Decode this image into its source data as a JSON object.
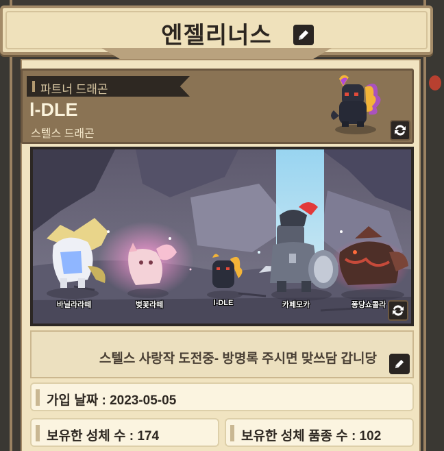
{
  "title": "엔젤리너스",
  "partner": {
    "tag_label": "파트너 드래곤",
    "name": "l-DLE",
    "type": "스텔스 드래곤"
  },
  "scene": {
    "dragons": [
      {
        "name": "바닐라라떼"
      },
      {
        "name": "벚꽃라떼"
      },
      {
        "name": "l-DLE"
      },
      {
        "name": "카페모카"
      },
      {
        "name": "퐁당쇼콜라"
      }
    ]
  },
  "bio": "스텔스 사랑작 도전중- 방명록 주시면 맞쓰담 갑니당",
  "info": {
    "join_date": "가입 날짜 : 2023-05-05",
    "owned_adults": "보유한 성체 수 : 174",
    "owned_species": "보유한 성체 품종 수 : 102"
  },
  "icons": {
    "title_edit": "pencil-icon",
    "bio_edit": "pencil-icon",
    "partner_swap": "swap-icon",
    "scene_swap": "swap-icon"
  },
  "colors": {
    "panel_bg": "#f1e4c1",
    "frame": "#a48b68",
    "partner_box": "#8a7354"
  }
}
